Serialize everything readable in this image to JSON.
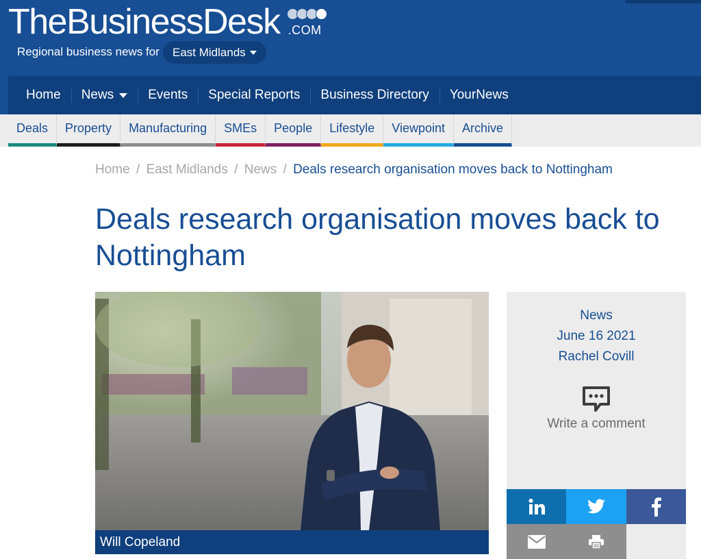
{
  "header": {
    "logo_text_light": "The",
    "logo_text_bold": "BusinessDesk",
    "logo_domain": ".COM",
    "region_prefix": "Regional business news for",
    "region_selected": "East Midlands"
  },
  "main_nav": [
    "Home",
    "News",
    "Events",
    "Special Reports",
    "Business Directory",
    "YourNews"
  ],
  "category_nav": [
    {
      "label": "Deals",
      "color": "#1b8a7a"
    },
    {
      "label": "Property",
      "color": "#1e1e1e"
    },
    {
      "label": "Manufacturing",
      "color": "#8c8c8c"
    },
    {
      "label": "SMEs",
      "color": "#c9263b"
    },
    {
      "label": "People",
      "color": "#7d2066"
    },
    {
      "label": "Lifestyle",
      "color": "#f3a81c"
    },
    {
      "label": "Viewpoint",
      "color": "#25a9e0"
    },
    {
      "label": "Archive",
      "color": "#174e94"
    }
  ],
  "breadcrumb": {
    "items": [
      "Home",
      "East Midlands",
      "News"
    ],
    "separator": "/",
    "current": "Deals research organisation moves back to Nottingham"
  },
  "article": {
    "title": "Deals research organisation moves back to Nottingham",
    "image_caption": "Will Copeland",
    "category": "News",
    "date": "June 16 2021",
    "author": "Rachel Covill",
    "comment_label": "Write a comment"
  },
  "share": {
    "buttons": [
      {
        "name": "linkedin",
        "icon": "linkedin-icon",
        "color": "#0f6fae"
      },
      {
        "name": "twitter",
        "icon": "twitter-icon",
        "color": "#1da1f2"
      },
      {
        "name": "facebook",
        "icon": "facebook-icon",
        "color": "#3b5998"
      },
      {
        "name": "email",
        "icon": "email-icon",
        "color": "#8e8e8e"
      },
      {
        "name": "print",
        "icon": "print-icon",
        "color": "#8e8e8e"
      }
    ]
  },
  "colors": {
    "brand_blue": "#174e94",
    "nav_dark": "#0f3f7c",
    "panel_grey": "#ececec"
  }
}
